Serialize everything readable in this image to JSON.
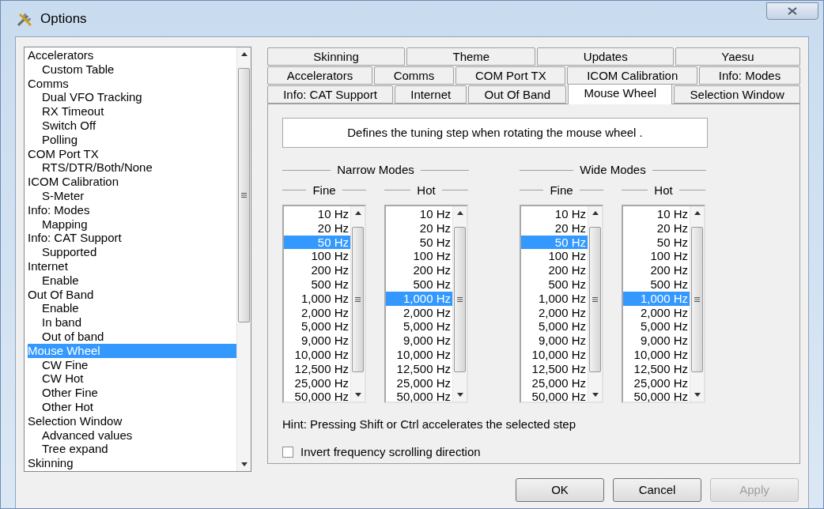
{
  "window": {
    "title": "Options"
  },
  "tree": [
    {
      "label": "Accelerators",
      "selected": false,
      "children": [
        {
          "label": "Custom Table",
          "selected": false
        }
      ]
    },
    {
      "label": "Comms",
      "selected": false,
      "children": [
        {
          "label": "Dual VFO Tracking",
          "selected": false
        },
        {
          "label": "RX Timeout",
          "selected": false
        },
        {
          "label": "Switch Off",
          "selected": false
        },
        {
          "label": "Polling",
          "selected": false
        }
      ]
    },
    {
      "label": "COM Port TX",
      "selected": false,
      "children": [
        {
          "label": "RTS/DTR/Both/None",
          "selected": false
        }
      ]
    },
    {
      "label": "ICOM Calibration",
      "selected": false,
      "children": [
        {
          "label": "S-Meter",
          "selected": false
        }
      ]
    },
    {
      "label": "Info: Modes",
      "selected": false,
      "children": [
        {
          "label": "Mapping",
          "selected": false
        }
      ]
    },
    {
      "label": "Info: CAT Support",
      "selected": false,
      "children": [
        {
          "label": "Supported",
          "selected": false
        }
      ]
    },
    {
      "label": "Internet",
      "selected": false,
      "children": [
        {
          "label": "Enable",
          "selected": false
        }
      ]
    },
    {
      "label": "Out Of Band",
      "selected": false,
      "children": [
        {
          "label": "Enable",
          "selected": false
        },
        {
          "label": "In band",
          "selected": false
        },
        {
          "label": "Out of band",
          "selected": false
        }
      ]
    },
    {
      "label": "Mouse Wheel",
      "selected": true,
      "children": [
        {
          "label": "CW Fine",
          "selected": false
        },
        {
          "label": "CW Hot",
          "selected": false
        },
        {
          "label": "Other Fine",
          "selected": false
        },
        {
          "label": "Other Hot",
          "selected": false
        }
      ]
    },
    {
      "label": "Selection Window",
      "selected": false,
      "children": [
        {
          "label": "Advanced values",
          "selected": false
        },
        {
          "label": "Tree expand",
          "selected": false
        }
      ]
    },
    {
      "label": "Skinning",
      "selected": false
    }
  ],
  "tab_rows": [
    [
      {
        "label": "Skinning",
        "selected": false
      },
      {
        "label": "Theme",
        "selected": false
      },
      {
        "label": "Updates",
        "selected": false
      },
      {
        "label": "Yaesu",
        "selected": false
      }
    ],
    [
      {
        "label": "Accelerators",
        "selected": false
      },
      {
        "label": "Comms",
        "selected": false
      },
      {
        "label": "COM Port TX",
        "selected": false
      },
      {
        "label": "ICOM Calibration",
        "selected": false
      },
      {
        "label": "Info: Modes",
        "selected": false
      }
    ],
    [
      {
        "label": "Info: CAT Support",
        "selected": false
      },
      {
        "label": "Internet",
        "selected": false
      },
      {
        "label": "Out Of Band",
        "selected": false
      },
      {
        "label": "Mouse Wheel",
        "selected": true
      },
      {
        "label": "Selection Window",
        "selected": false
      }
    ]
  ],
  "description": "Defines the tuning step when rotating the mouse wheel .",
  "groups": [
    {
      "title": "Narrow Modes",
      "lists": [
        {
          "title": "Fine",
          "items": [
            {
              "label": "10 Hz",
              "selected": false
            },
            {
              "label": "20 Hz",
              "selected": false
            },
            {
              "label": "50 Hz",
              "selected": true
            },
            {
              "label": "100 Hz",
              "selected": false
            },
            {
              "label": "200 Hz",
              "selected": false
            },
            {
              "label": "500 Hz",
              "selected": false
            },
            {
              "label": "1,000 Hz",
              "selected": false
            },
            {
              "label": "2,000 Hz",
              "selected": false
            },
            {
              "label": "5,000 Hz",
              "selected": false
            },
            {
              "label": "9,000 Hz",
              "selected": false
            },
            {
              "label": "10,000 Hz",
              "selected": false
            },
            {
              "label": "12,500 Hz",
              "selected": false
            },
            {
              "label": "25,000 Hz",
              "selected": false
            },
            {
              "label": "50,000 Hz",
              "selected": false
            }
          ]
        },
        {
          "title": "Hot",
          "items": [
            {
              "label": "10 Hz",
              "selected": false
            },
            {
              "label": "20 Hz",
              "selected": false
            },
            {
              "label": "50 Hz",
              "selected": false
            },
            {
              "label": "100 Hz",
              "selected": false
            },
            {
              "label": "200 Hz",
              "selected": false
            },
            {
              "label": "500 Hz",
              "selected": false
            },
            {
              "label": "1,000 Hz",
              "selected": true
            },
            {
              "label": "2,000 Hz",
              "selected": false
            },
            {
              "label": "5,000 Hz",
              "selected": false
            },
            {
              "label": "9,000 Hz",
              "selected": false
            },
            {
              "label": "10,000 Hz",
              "selected": false
            },
            {
              "label": "12,500 Hz",
              "selected": false
            },
            {
              "label": "25,000 Hz",
              "selected": false
            },
            {
              "label": "50,000 Hz",
              "selected": false
            }
          ]
        }
      ]
    },
    {
      "title": "Wide Modes",
      "lists": [
        {
          "title": "Fine",
          "items": [
            {
              "label": "10 Hz",
              "selected": false
            },
            {
              "label": "20 Hz",
              "selected": false
            },
            {
              "label": "50 Hz",
              "selected": true
            },
            {
              "label": "100 Hz",
              "selected": false
            },
            {
              "label": "200 Hz",
              "selected": false
            },
            {
              "label": "500 Hz",
              "selected": false
            },
            {
              "label": "1,000 Hz",
              "selected": false
            },
            {
              "label": "2,000 Hz",
              "selected": false
            },
            {
              "label": "5,000 Hz",
              "selected": false
            },
            {
              "label": "9,000 Hz",
              "selected": false
            },
            {
              "label": "10,000 Hz",
              "selected": false
            },
            {
              "label": "12,500 Hz",
              "selected": false
            },
            {
              "label": "25,000 Hz",
              "selected": false
            },
            {
              "label": "50,000 Hz",
              "selected": false
            }
          ]
        },
        {
          "title": "Hot",
          "items": [
            {
              "label": "10 Hz",
              "selected": false
            },
            {
              "label": "20 Hz",
              "selected": false
            },
            {
              "label": "50 Hz",
              "selected": false
            },
            {
              "label": "100 Hz",
              "selected": false
            },
            {
              "label": "200 Hz",
              "selected": false
            },
            {
              "label": "500 Hz",
              "selected": false
            },
            {
              "label": "1,000 Hz",
              "selected": true
            },
            {
              "label": "2,000 Hz",
              "selected": false
            },
            {
              "label": "5,000 Hz",
              "selected": false
            },
            {
              "label": "9,000 Hz",
              "selected": false
            },
            {
              "label": "10,000 Hz",
              "selected": false
            },
            {
              "label": "12,500 Hz",
              "selected": false
            },
            {
              "label": "25,000 Hz",
              "selected": false
            },
            {
              "label": "50,000 Hz",
              "selected": false
            }
          ]
        }
      ]
    }
  ],
  "hint": "Hint: Pressing Shift or Ctrl accelerates the selected step",
  "invert_option": {
    "label": "Invert frequency scrolling direction",
    "checked": false
  },
  "buttons": [
    {
      "label": "OK",
      "disabled": false
    },
    {
      "label": "Cancel",
      "disabled": false
    },
    {
      "label": "Apply",
      "disabled": true
    }
  ]
}
